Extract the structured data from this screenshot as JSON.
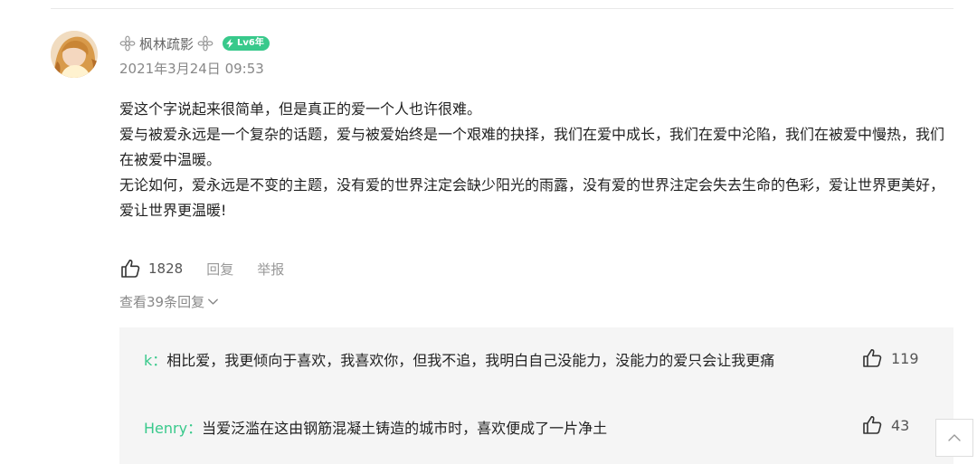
{
  "comment": {
    "username": "枫林疏影",
    "level_badge": "Lv6年",
    "timestamp": "2021年3月24日 09:53",
    "paragraphs": [
      "爱这个字说起来很简单，但是真正的爱一个人也许很难。",
      "爱与被爱永远是一个复杂的话题，爱与被爱始终是一个艰难的抉择，我们在爱中成长，我们在爱中沦陷，我们在被爱中慢热，我们在被爱中温暖。",
      "无论如何，爱永远是不变的主题，没有爱的世界注定会缺少阳光的雨露，没有爱的世界注定会失去生命的色彩，爱让世界更美好，爱让世界更温暖!"
    ],
    "likes": "1828",
    "reply_label": "回复",
    "report_label": "举报",
    "view_replies_label": "查看39条回复"
  },
  "replies": [
    {
      "user": "k",
      "separator": "：",
      "text": "相比爱，我更倾向于喜欢，我喜欢你，但我不追，我明白自己没能力，没能力的爱只会让我更痛",
      "likes": "119"
    },
    {
      "user": "Henry",
      "separator": "：",
      "text": "当爱泛滥在这由钢筋混凝土铸造的城市时，喜欢便成了一片净土",
      "likes": "43"
    }
  ],
  "icons": {
    "decoration_left": "flower-badge-icon",
    "decoration_right": "flower-badge-icon",
    "level": "lightning-bolt-icon",
    "like": "thumbs-up-icon",
    "expand": "chevron-down-icon",
    "back_to_top": "chevron-up-icon"
  },
  "colors": {
    "accent_green": "#38c98b",
    "reply_background": "#f5f5f5",
    "muted_text": "#888888"
  }
}
